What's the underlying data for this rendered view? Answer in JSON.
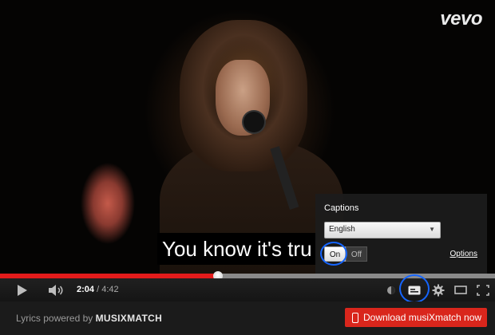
{
  "player": {
    "brand_logo": "vevo",
    "subtitle_text": "You know it's tru",
    "captions_panel": {
      "title": "Captions",
      "language_selected": "English",
      "toggle_on_label": "On",
      "toggle_off_label": "Off",
      "options_link": "Options"
    },
    "progress": {
      "played_fraction": 0.44,
      "buffered_fraction": 1.0
    },
    "time": {
      "current": "2:04",
      "separator": "/",
      "duration": "4:42"
    },
    "icons": {
      "play": "play-icon",
      "volume": "volume-icon",
      "annotations": "annotations-icon",
      "captions": "captions-icon",
      "settings": "gear-icon",
      "size": "theater-size-icon",
      "fullscreen": "fullscreen-icon"
    },
    "highlight_color": "#1565ff",
    "progress_color": "#e31b1b"
  },
  "footer": {
    "lyrics_prefix": "Lyrics powered by ",
    "lyrics_brand": "MUSIXMATCH",
    "download_label": "Download musiXmatch now",
    "download_color": "#d9261c"
  }
}
